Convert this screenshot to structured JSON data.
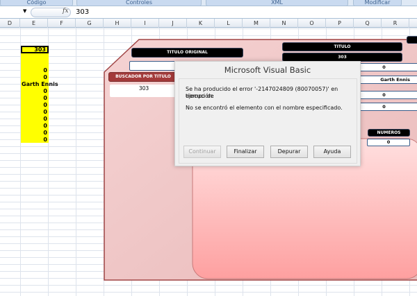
{
  "ribbon": {
    "groups": [
      "Código",
      "Controles",
      "XML",
      "Modificar"
    ]
  },
  "formula_bar": {
    "fx_label": "fx",
    "value": "303"
  },
  "columns": [
    "D",
    "E",
    "F",
    "G",
    "H",
    "I",
    "J",
    "K",
    "L",
    "M",
    "N",
    "O",
    "P",
    "Q",
    "R"
  ],
  "sheet_cells": {
    "e_top": "303",
    "e_values": [
      "0",
      "0",
      "Garth Ennis",
      "0",
      "0",
      "0",
      "0",
      "0",
      "0",
      "0",
      "0"
    ]
  },
  "form": {
    "titulo_original_label": "TITULO ORIGINAL",
    "titulo_original_value": "",
    "buscador_label": "BUSCADOR POR TITULO",
    "buscador_value": "303",
    "titulo_label": "TITULO",
    "titulo_value": "303",
    "right_fields": [
      "0",
      "Garth Ennis",
      "0",
      "0"
    ],
    "numeros_label": "NUMEROS",
    "numeros_value": "0"
  },
  "dialog": {
    "title": "Microsoft Visual Basic",
    "message_line1": "Se ha producido el error '-2147024809 (80070057)' en tiempo de",
    "message_line2": "ejecución:",
    "message_detail": "No se encontró el elemento con el nombre especificado.",
    "buttons": {
      "continuar": "Continuar",
      "finalizar": "Finalizar",
      "depurar": "Depurar",
      "ayuda": "Ayuda"
    }
  },
  "colors": {
    "panel": "#f0c8c8",
    "panel_border": "#a04040",
    "header_red": "#a33a3a",
    "highlight": "#ffff00"
  }
}
